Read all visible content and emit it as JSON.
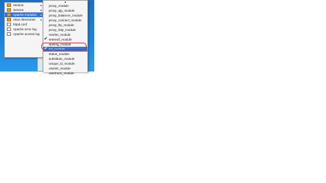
{
  "main_menu": {
    "items": [
      {
        "label": "Version",
        "icon": "folder-icon",
        "has_submenu": true
      },
      {
        "label": "Service",
        "icon": "folder-icon",
        "has_submenu": true
      },
      {
        "label": "Apache modules",
        "icon": "folder-icon",
        "has_submenu": true
      },
      {
        "label": "Alias directories",
        "icon": "folder-icon",
        "has_submenu": true
      },
      {
        "label": "httpd.conf",
        "icon": "file-icon",
        "has_submenu": false
      },
      {
        "label": "Apache error log",
        "icon": "file-icon",
        "has_submenu": false
      },
      {
        "label": "Apache access log",
        "icon": "file-icon",
        "has_submenu": false
      }
    ],
    "submenu_arrow": "▸"
  },
  "sub_menu": {
    "scroll_up": "▲",
    "items": [
      {
        "label": "proxy_module",
        "checked": false
      },
      {
        "label": "proxy_ajp_module",
        "checked": false
      },
      {
        "label": "proxy_balancer_module",
        "checked": false
      },
      {
        "label": "proxy_connect_module",
        "checked": false
      },
      {
        "label": "proxy_ftp_module",
        "checked": false
      },
      {
        "label": "proxy_http_module",
        "checked": false
      },
      {
        "label": "rewrite_module",
        "checked": false
      },
      {
        "label": "setenvif_module",
        "checked": true
      },
      {
        "label": "speling_module",
        "checked": false
      },
      {
        "label": "ssl_module",
        "checked": true
      },
      {
        "label": "status_module",
        "checked": false
      },
      {
        "label": "substitute_module",
        "checked": false
      },
      {
        "label": "unique_id_module",
        "checked": false
      },
      {
        "label": "userdir_module",
        "checked": false
      },
      {
        "label": "usertrack_module",
        "checked": false
      }
    ],
    "check_mark": "✔"
  },
  "colors": {
    "highlight": "#3a75d4",
    "callout": "#d42525",
    "desktop": "#1a84dc"
  }
}
